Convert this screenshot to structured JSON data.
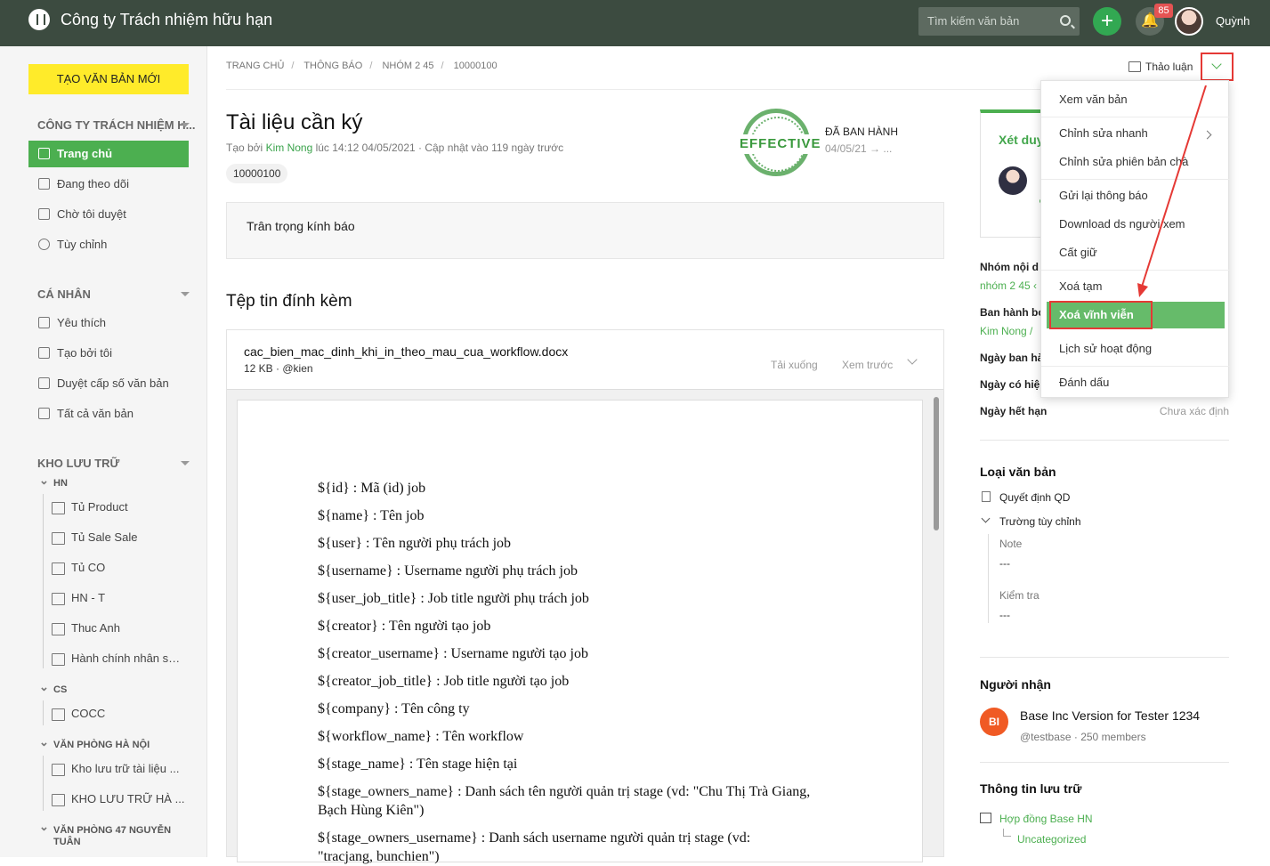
{
  "topbar": {
    "company": "Công ty Trách nhiệm hữu hạn",
    "search_placeholder": "Tìm kiếm văn bản",
    "notifications": "85",
    "user": "Quỳnh"
  },
  "sidebar": {
    "new_document": "TẠO VĂN BẢN MỚI",
    "org": "CÔNG TY TRÁCH NHIỆM H...",
    "main_items": [
      "Trang chủ",
      "Đang theo dõi",
      "Chờ tôi duyệt",
      "Tùy chỉnh"
    ],
    "personal_title": "CÁ NHÂN",
    "personal_items": [
      "Yêu thích",
      "Tạo bởi tôi",
      "Duyệt cấp số văn bản",
      "Tất cả văn bản"
    ],
    "storage_title": "KHO LƯU TRỮ",
    "storage_groups": [
      {
        "name": "HN",
        "items": [
          "Tủ Product",
          "Tủ Sale Sale",
          "Tủ CO",
          "HN - T",
          "Thuc Anh",
          "Hành chính nhân sự..."
        ]
      },
      {
        "name": "CS",
        "items": [
          "COCC"
        ]
      },
      {
        "name": "VĂN PHÒNG HÀ NỘI",
        "items": [
          "Kho lưu trữ tài liệu ...",
          "KHO LƯU TRỮ HÀ ..."
        ]
      },
      {
        "name": "VĂN PHÒNG 47 NGUYỄN TUÂN",
        "items": []
      }
    ]
  },
  "breadcrumb": [
    "TRANG CHỦ",
    "THÔNG BÁO",
    "NHÓM 2 45",
    "10000100"
  ],
  "actions": {
    "discussion": "Thảo luận"
  },
  "document": {
    "title": "Tài liệu cần ký",
    "created_prefix": "Tạo bởi ",
    "creator": "Kim Nong",
    "created_suffix": " lúc 14:12 04/05/2021 · Cập nhật vào 119 ngày trước",
    "number": "10000100",
    "stamp": "EFFECTIVE",
    "status": "ĐÃ BAN HÀNH",
    "status_date": "04/05/21 → ...",
    "note": "Trân trọng kính báo",
    "attachments_title": "Tệp tin đính kèm",
    "file": {
      "name": "cac_bien_mac_dinh_khi_in_theo_mau_cua_workflow.docx",
      "meta": "12 KB · @kien",
      "download": "Tải xuống",
      "preview": "Xem trước"
    },
    "preview_lines": [
      "${id} : Mã (id) job",
      "${name} : Tên job",
      "${user} : Tên người phụ trách job",
      "${username} : Username người phụ trách job",
      "${user_job_title} : Job title người phụ trách job",
      "${creator} : Tên người tạo job",
      "${creator_username} : Username người tạo job",
      "${creator_job_title} :  Job title người tạo job",
      "${company} : Tên công ty",
      "${workflow_name} : Tên workflow",
      "${stage_name} : Tên stage hiện tại",
      "${stage_owners_name} : Danh sách tên người quản trị stage (vd: \"Chu Thị Trà Giang, Bạch Hùng Kiên\")",
      "${stage_owners_username} : Danh sách username người quản trị stage (vd:",
      "\"tracjang, bunchien\")"
    ]
  },
  "right_panel": {
    "review": "Xét duy",
    "info": [
      {
        "label": "Nhóm nội d",
        "value": "nhóm 2 45 ‹"
      },
      {
        "label": "Ban hành bở",
        "value": "Kim Nong /"
      },
      {
        "label": "Ngày ban hà",
        "value": ""
      },
      {
        "label": "Ngày có hiệ",
        "value": ""
      },
      {
        "label": "Ngày hết hạn",
        "value": "Chưa xác định"
      }
    ],
    "type_title": "Loại văn bản",
    "type_value": "Quyết định QD",
    "custom_fields_title": "Trường tùy chỉnh",
    "fields": [
      {
        "label": "Note",
        "value": "---"
      },
      {
        "label": "Kiểm tra",
        "value": "---"
      }
    ],
    "recipients_title": "Người nhận",
    "recipient": {
      "initials": "BI",
      "name": "Base Inc Version for Tester 1234",
      "meta": "@testbase · 250 members"
    },
    "archive_title": "Thông tin lưu trữ",
    "archive": "Hợp đồng Base HN",
    "archive_sub": "Uncategorized"
  },
  "menu": {
    "items": [
      "Xem văn bản",
      "Chỉnh sửa nhanh",
      "Chỉnh sửa phiên bản chà",
      "Gửi lại thông báo",
      "Download ds người xem",
      "Cất giữ",
      "Xoá tạm",
      "Xoá vĩnh viễn",
      "Lịch sử hoạt động",
      "Đánh dấu"
    ]
  }
}
